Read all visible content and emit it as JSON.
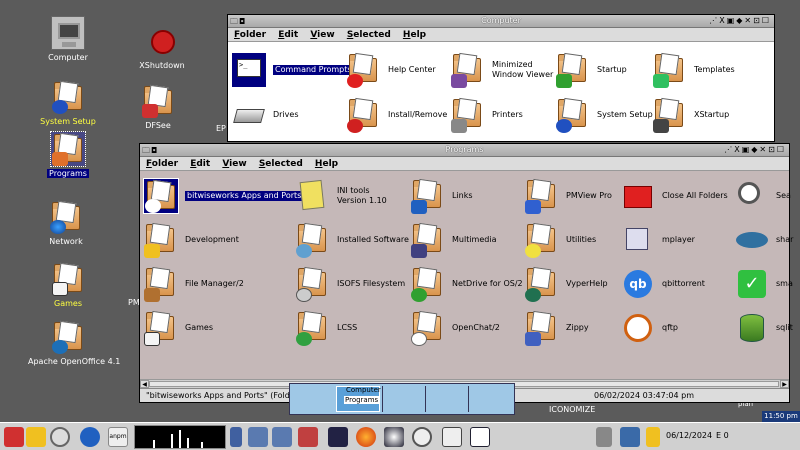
{
  "desktop": {
    "icons": [
      {
        "label": "Computer"
      },
      {
        "label": "System Setup"
      },
      {
        "label": "Programs"
      },
      {
        "label": "Network"
      },
      {
        "label": "Games"
      },
      {
        "label": "Apache OpenOffice 4.1"
      },
      {
        "label": "XShutdown"
      },
      {
        "label": "DFSee"
      }
    ],
    "partial_labels": {
      "ep": "EP",
      "pm": "PM",
      "iconomize": "ICONOMIZE",
      "plan": "plan"
    }
  },
  "computer_window": {
    "title": "Computer",
    "menu": [
      "Folder",
      "Edit",
      "View",
      "Selected",
      "Help"
    ],
    "items": [
      {
        "label": "Command Prompts"
      },
      {
        "label": "Help Center"
      },
      {
        "label": "Minimized\nWindow Viewer"
      },
      {
        "label": "Startup"
      },
      {
        "label": "Templates"
      },
      {
        "label": "Drives"
      },
      {
        "label": "Install/Remove"
      },
      {
        "label": "Printers"
      },
      {
        "label": "System Setup"
      },
      {
        "label": "XStartup"
      }
    ]
  },
  "programs_window": {
    "title": "Programs",
    "menu": [
      "Folder",
      "Edit",
      "View",
      "Selected",
      "Help"
    ],
    "items": [
      {
        "label": "bitwiseworks Apps and Ports"
      },
      {
        "label": "INI tools\nVersion 1.10"
      },
      {
        "label": "Links"
      },
      {
        "label": "PMView Pro"
      },
      {
        "label": "Close All Folders"
      },
      {
        "label": "Sea"
      },
      {
        "label": "Development"
      },
      {
        "label": "Installed Software"
      },
      {
        "label": "Multimedia"
      },
      {
        "label": "Utilities"
      },
      {
        "label": "mplayer"
      },
      {
        "label": "shar"
      },
      {
        "label": "File Manager/2"
      },
      {
        "label": "ISOFS Filesystem"
      },
      {
        "label": "NetDrive for OS/2"
      },
      {
        "label": "VyperHelp"
      },
      {
        "label": "qbittorrent"
      },
      {
        "label": "sma"
      },
      {
        "label": "Games"
      },
      {
        "label": "LCSS"
      },
      {
        "label": "OpenChat/2"
      },
      {
        "label": "Zippy"
      },
      {
        "label": "qftp"
      },
      {
        "label": "sqlit"
      }
    ],
    "status_left": "\"bitwiseworks Apps and Ports\" (Folder)",
    "status_right": "06/02/2024 03:47:04 pm"
  },
  "switch_list": {
    "items": [
      "Computer",
      "Programs"
    ]
  },
  "taskbar": {
    "ampm": "anpm",
    "date": "06/12/2024",
    "extra": "E 0",
    "clock": "11:50 pm"
  }
}
